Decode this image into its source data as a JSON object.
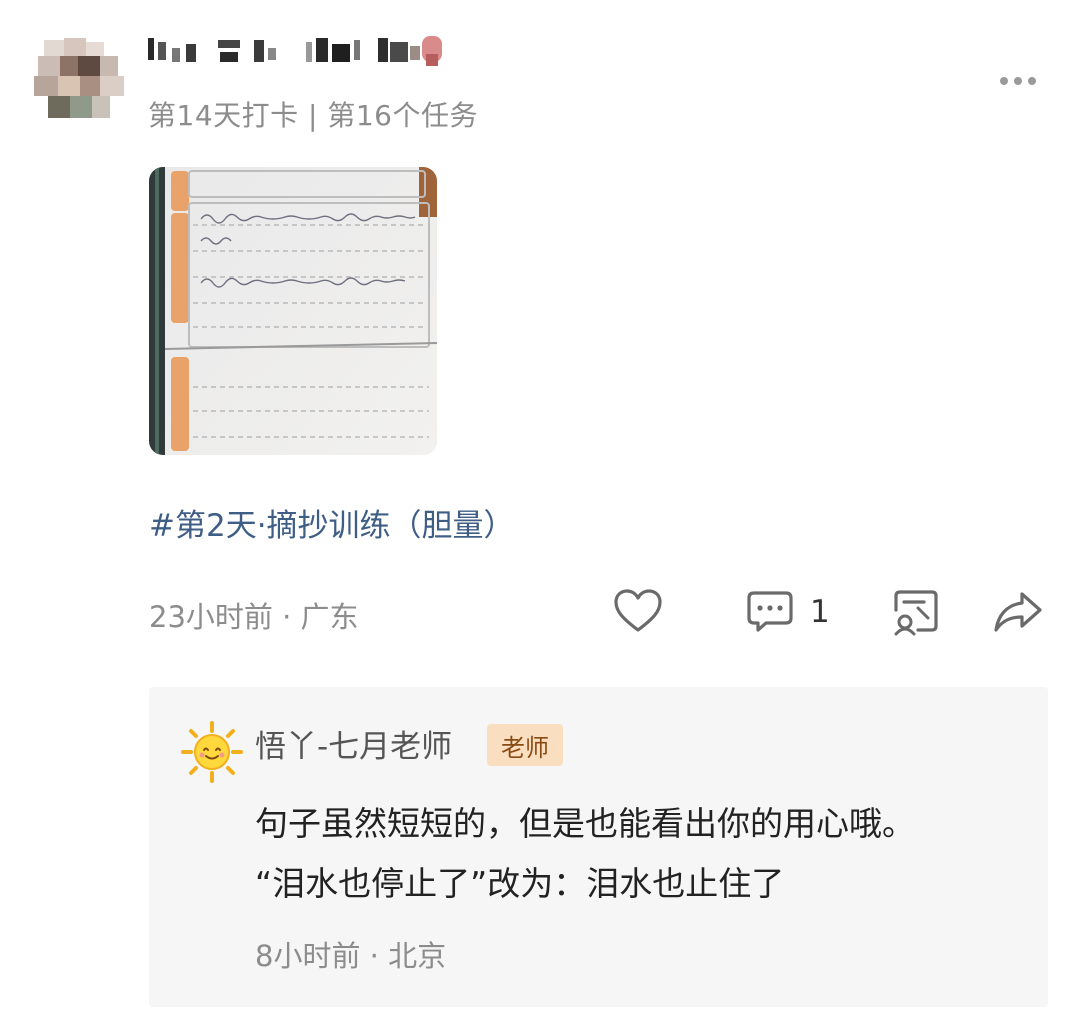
{
  "post": {
    "checkin_text": "第14天打卡 | 第16个任务",
    "topic": "#第2天·摘抄训练（胆量）",
    "time_location": "23小时前 · 广东",
    "photo_icon": "notebook-photo"
  },
  "actions": {
    "like_icon": "heart-icon",
    "comment_icon": "comment-icon",
    "comment_count": "1",
    "collect_icon": "collect-icon",
    "share_icon": "share-icon",
    "more_icon": "more-dots-icon"
  },
  "reply": {
    "name": "悟丫-七月老师",
    "badge": "老师",
    "line1": "句子虽然短短的，但是也能看出你的用心哦。",
    "line2": "“泪水也停止了”改为：泪水也止住了",
    "time_location": "8小时前 · 北京",
    "avatar_icon": "sun-icon"
  },
  "colors": {
    "topic": "#3f5e86",
    "meta": "#8c8c8c",
    "card_bg": "#f6f6f6",
    "badge_bg": "#f9dfbf",
    "badge_text": "#8a4a14"
  }
}
